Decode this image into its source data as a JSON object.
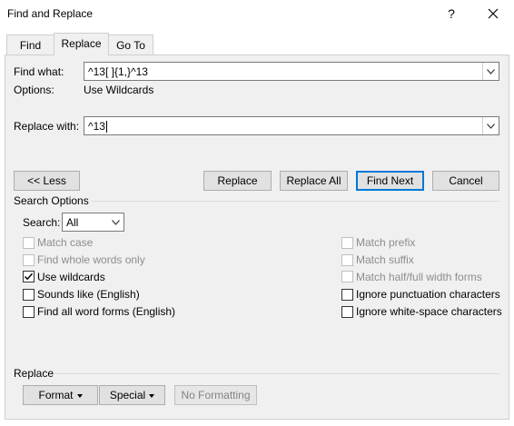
{
  "window": {
    "title": "Find and Replace",
    "help_glyph": "?",
    "close_glyph": "✕"
  },
  "tabs": [
    {
      "label": "Find"
    },
    {
      "label": "Replace"
    },
    {
      "label": "Go To"
    }
  ],
  "find": {
    "label": "Find what:",
    "value": "^13[ ]{1,}^13"
  },
  "options": {
    "label": "Options:",
    "value": "Use Wildcards"
  },
  "replace": {
    "label": "Replace with:",
    "value": "^13"
  },
  "buttons": {
    "less": "<< Less",
    "replace": "Replace",
    "replace_all": "Replace All",
    "find_next": "Find Next",
    "cancel": "Cancel"
  },
  "search_options": {
    "heading": "Search Options",
    "search_label": "Search:",
    "search_value": "All",
    "left": [
      {
        "label": "Match case",
        "checked": false,
        "disabled": true
      },
      {
        "label": "Find whole words only",
        "checked": false,
        "disabled": true
      },
      {
        "label": "Use wildcards",
        "checked": true,
        "disabled": false
      },
      {
        "label": "Sounds like (English)",
        "checked": false,
        "disabled": false
      },
      {
        "label": "Find all word forms (English)",
        "checked": false,
        "disabled": false
      }
    ],
    "right": [
      {
        "label": "Match prefix",
        "checked": false,
        "disabled": true
      },
      {
        "label": "Match suffix",
        "checked": false,
        "disabled": true
      },
      {
        "label": "Match half/full width forms",
        "checked": false,
        "disabled": true
      },
      {
        "label": "Ignore punctuation characters",
        "checked": false,
        "disabled": false
      },
      {
        "label": "Ignore white-space characters",
        "checked": false,
        "disabled": false
      }
    ]
  },
  "replace_section": {
    "heading": "Replace",
    "format": "Format",
    "special": "Special",
    "no_formatting": "No Formatting"
  },
  "colors": {
    "accent": "#0078d7",
    "panel": "#f0f0f0",
    "disabled_text": "#8d8d8d"
  }
}
